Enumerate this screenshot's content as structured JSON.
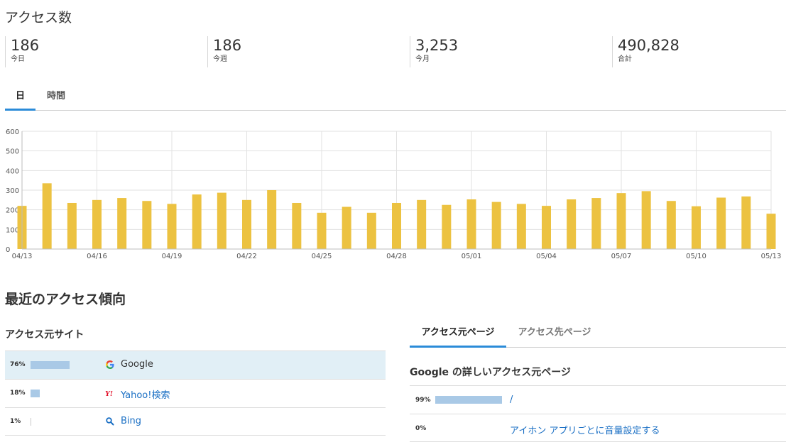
{
  "header": {
    "title": "アクセス数"
  },
  "stats": [
    {
      "value": "186",
      "label": "今日"
    },
    {
      "value": "186",
      "label": "今週"
    },
    {
      "value": "3,253",
      "label": "今月"
    },
    {
      "value": "490,828",
      "label": "合計"
    }
  ],
  "period_tabs": [
    {
      "label": "日",
      "active": true
    },
    {
      "label": "時間",
      "active": false
    }
  ],
  "chart_data": {
    "type": "bar",
    "ylim": [
      0,
      600
    ],
    "y_ticks": [
      0,
      100,
      200,
      300,
      400,
      500,
      600
    ],
    "x_tick_labels": [
      "04/13",
      "04/16",
      "04/19",
      "04/22",
      "04/25",
      "04/28",
      "05/01",
      "05/04",
      "05/07",
      "05/10",
      "05/13"
    ],
    "categories": [
      "04/13",
      "04/14",
      "04/15",
      "04/16",
      "04/17",
      "04/18",
      "04/19",
      "04/20",
      "04/21",
      "04/22",
      "04/23",
      "04/24",
      "04/25",
      "04/26",
      "04/27",
      "04/28",
      "04/29",
      "04/30",
      "05/01",
      "05/02",
      "05/03",
      "05/04",
      "05/05",
      "05/06",
      "05/07",
      "05/08",
      "05/09",
      "05/10",
      "05/11",
      "05/12",
      "05/13"
    ],
    "values": [
      220,
      335,
      235,
      250,
      260,
      245,
      230,
      278,
      287,
      250,
      300,
      235,
      185,
      215,
      185,
      235,
      250,
      225,
      253,
      240,
      230,
      220,
      253,
      260,
      285,
      295,
      245,
      218,
      262,
      268,
      180
    ],
    "bar_color": "#ecc241",
    "grid": true
  },
  "recent": {
    "title": "最近のアクセス傾向"
  },
  "referrer_sites": {
    "title": "アクセス元サイト",
    "rows": [
      {
        "percent": "76%",
        "ratio": 0.76,
        "icon": "google-icon",
        "name": "Google",
        "highlight": true
      },
      {
        "percent": "18%",
        "ratio": 0.18,
        "icon": "yahoo-icon",
        "name": "Yahoo!検索",
        "highlight": false
      },
      {
        "percent": "1%",
        "ratio": 0.01,
        "icon": "search-icon",
        "name": "Bing",
        "highlight": false
      }
    ]
  },
  "page_tabs": [
    {
      "label": "アクセス元ページ",
      "active": true
    },
    {
      "label": "アクセス先ページ",
      "active": false
    }
  ],
  "referrer_pages": {
    "title": "Google の詳しいアクセス元ページ",
    "rows": [
      {
        "percent": "99%",
        "ratio": 0.99,
        "path": "/"
      },
      {
        "percent": "0%",
        "ratio": 0,
        "path": "アイホン アプリごとに音量設定する"
      }
    ]
  },
  "colors": {
    "accent": "#2b8bd8",
    "link": "#1a6fc4",
    "bar_fill": "#a9c9e6",
    "highlight_row": "#e1eff6"
  }
}
